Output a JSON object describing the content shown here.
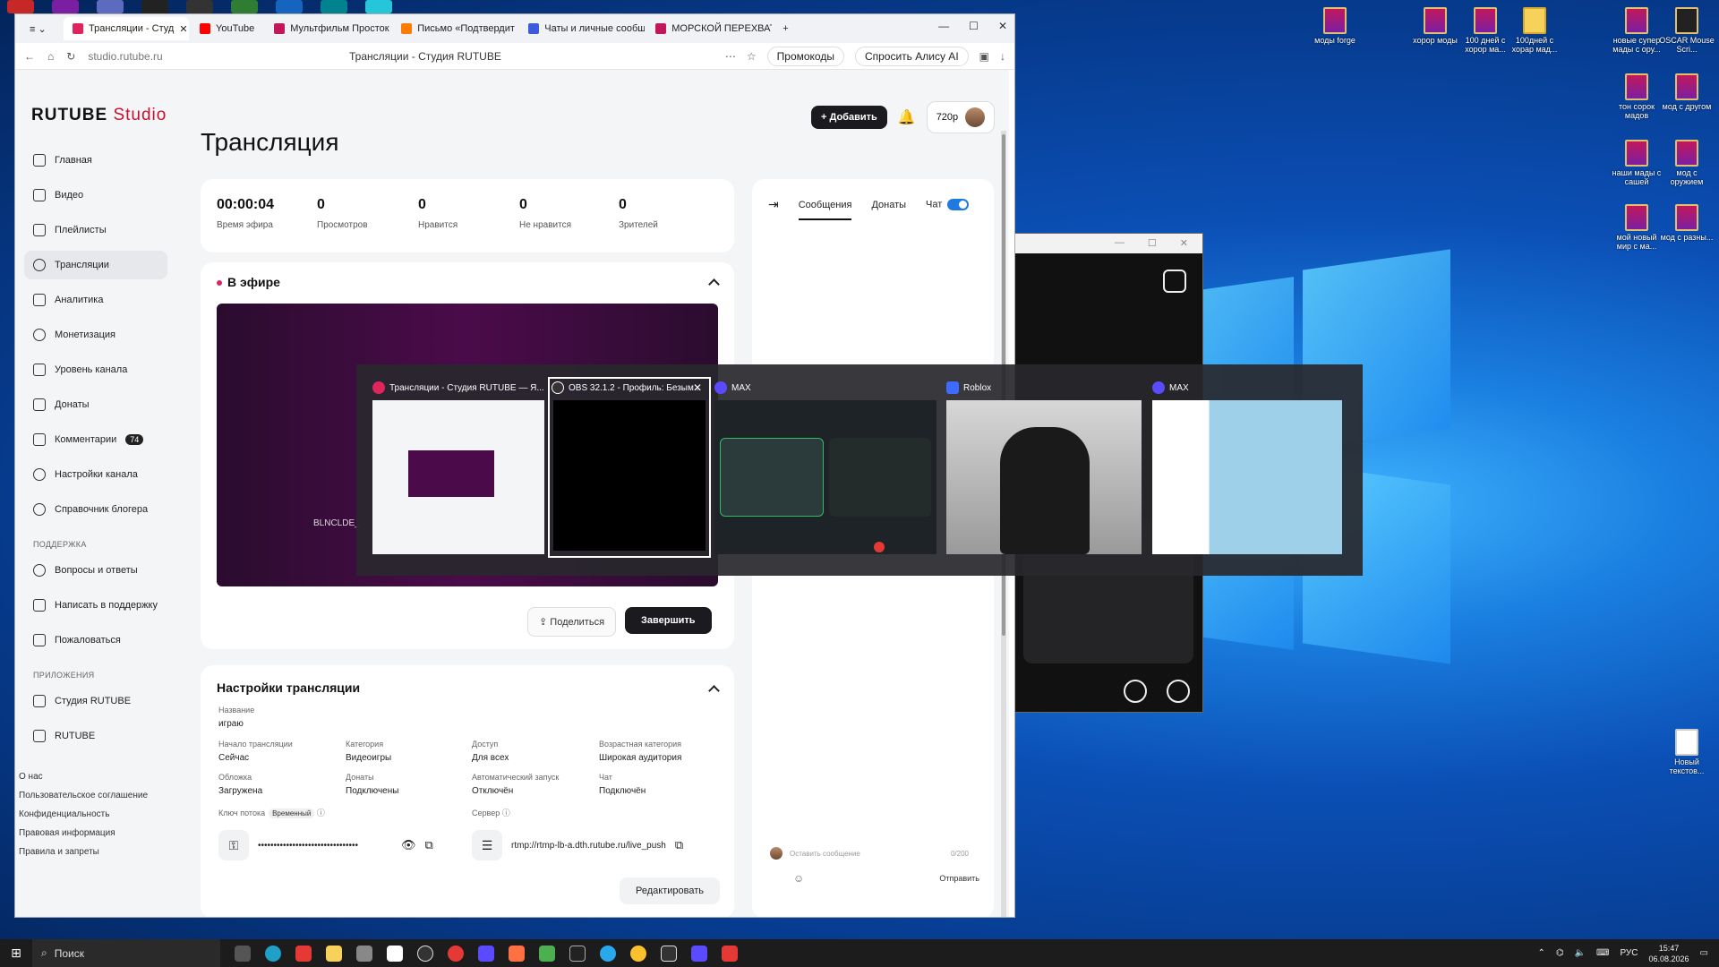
{
  "browser": {
    "tabs": [
      {
        "label": "Трансляции - Студ",
        "active": true,
        "color": "#e0245e"
      },
      {
        "label": "YouTube",
        "active": false,
        "color": "#ff0000"
      },
      {
        "label": "Мультфильм Просток",
        "active": false,
        "color": "#c2185b"
      },
      {
        "label": "Письмо «Подтвердит",
        "active": false,
        "color": "#ff7a00"
      },
      {
        "label": "Чаты и личные сообщ",
        "active": false,
        "color": "#3b5bdb"
      },
      {
        "label": "МОРСКОЙ ПЕРЕХВАТ",
        "active": false,
        "color": "#c2185b"
      }
    ],
    "url": "studio.rutube.ru",
    "page_title": "Трансляции - Студия RUTUBE",
    "promo": "Промокоды",
    "alice": "Спросить Алису AI"
  },
  "header": {
    "logo": "RUTUBE",
    "logo_sub": "Studio",
    "add_label": "Добавить",
    "quality": "720p"
  },
  "sidebar": {
    "items": [
      {
        "label": "Главная",
        "icon": "home-icon"
      },
      {
        "label": "Видео",
        "icon": "video-icon"
      },
      {
        "label": "Плейлисты",
        "icon": "playlist-icon"
      },
      {
        "label": "Трансляции",
        "icon": "broadcast-icon",
        "active": true
      },
      {
        "label": "Аналитика",
        "icon": "analytics-icon"
      },
      {
        "label": "Монетизация",
        "icon": "monetization-icon"
      },
      {
        "label": "Уровень канала",
        "icon": "star-icon"
      },
      {
        "label": "Донаты",
        "icon": "donate-icon"
      },
      {
        "label": "Комментарии",
        "icon": "comment-icon",
        "badge": "74"
      },
      {
        "label": "Настройки канала",
        "icon": "gear-icon"
      },
      {
        "label": "Справочник блогера",
        "icon": "info-icon"
      }
    ],
    "support_title": "ПОДДЕРЖКА",
    "support": [
      "Вопросы и ответы",
      "Написать в поддержку",
      "Пожаловаться"
    ],
    "apps_title": "ПРИЛОЖЕНИЯ",
    "apps": [
      "Студия RUTUBE",
      "RUTUBE"
    ],
    "footer": [
      "О нас",
      "Пользовательское соглашение",
      "Конфиденциальность",
      "Правовая информация",
      "Правила и запреты"
    ]
  },
  "main": {
    "title": "Трансляция",
    "stats": [
      {
        "value": "00:00:04",
        "label": "Время эфира"
      },
      {
        "value": "0",
        "label": "Просмотров"
      },
      {
        "value": "0",
        "label": "Нравится"
      },
      {
        "value": "0",
        "label": "Не нравится"
      },
      {
        "value": "0",
        "label": "Зрителей"
      }
    ],
    "live_title": "В эфире",
    "player_nick": "BLNCLDE_",
    "share_label": "Поделиться",
    "end_label": "Завершить",
    "settings_title": "Настройки трансляции",
    "settings": {
      "name_label": "Название",
      "name_value": "играю",
      "start_label": "Начало трансляции",
      "start_value": "Сейчас",
      "category_label": "Категория",
      "category_value": "Видеоигры",
      "access_label": "Доступ",
      "access_value": "Для всех",
      "age_label": "Возрастная категория",
      "age_value": "Широкая аудитория",
      "cover_label": "Обложка",
      "cover_value": "Загружена",
      "donates_label": "Донаты",
      "donates_value": "Подключены",
      "autostart_label": "Автоматический запуск",
      "autostart_value": "Отключён",
      "chat_label": "Чат",
      "chat_value": "Подключён",
      "key_label": "Ключ потока",
      "key_tag": "Временный",
      "key_value": "••••••••••••••••••••••••••••••••",
      "server_label": "Сервер",
      "server_value": "rtmp://rtmp-lb-a.dth.rutube.ru/live_push",
      "edit_label": "Редактировать"
    }
  },
  "chat": {
    "tab_messages": "Сообщения",
    "tab_donates": "Донаты",
    "chat_label": "Чат",
    "placeholder": "Оставить сообщение",
    "counter": "0/200",
    "send_label": "Отправить"
  },
  "alttab": {
    "windows": [
      {
        "title": "Трансляции - Студия RUTUBE — Я...",
        "color": "#e0245e"
      },
      {
        "title": "OBS 32.1.2 - Профиль: Безым...",
        "color": "#333333",
        "selected": true
      },
      {
        "title": "MAX",
        "color": "#5b4bff"
      },
      {
        "title": "Roblox",
        "color": "#3d6bff"
      },
      {
        "title": "MAX",
        "color": "#5b4bff"
      }
    ]
  },
  "desktop": {
    "icons": [
      "моды forge",
      "хорор моды",
      "100 дней с хорор ма...",
      "100дней с хорар мад...",
      "новые супер мады с ору...",
      "OSCAR Mouse Scri...",
      "тон сорок мадов",
      "мод с другом",
      "наши мады с сашей",
      "мод с оружием",
      "мой новый мир с ма...",
      "мод с разны...",
      "Новый текстов..."
    ]
  },
  "taskbar": {
    "search": "Поиск",
    "lang": "РУС",
    "time": "15:47",
    "date": "06.08.2026"
  }
}
